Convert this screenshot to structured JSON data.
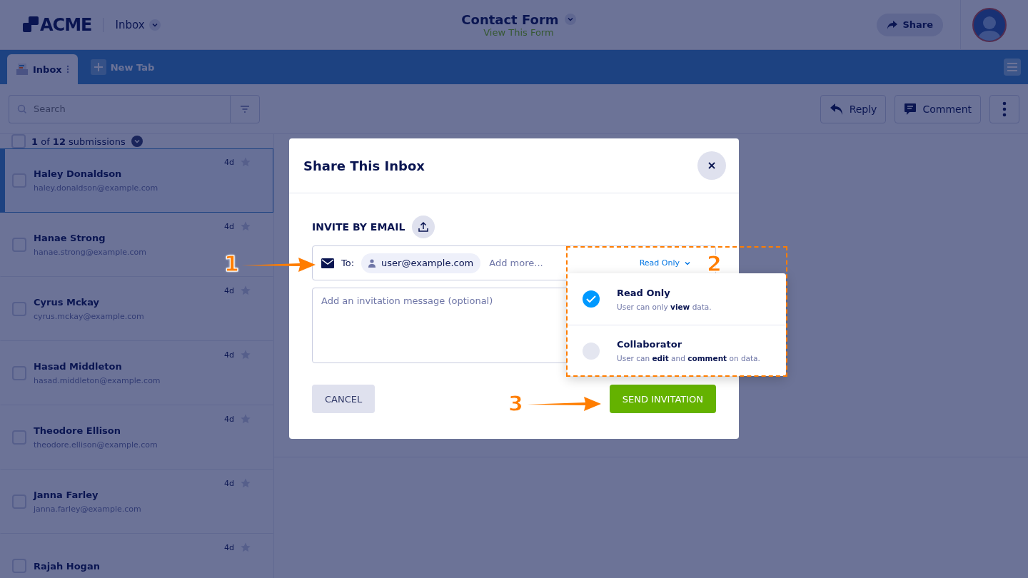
{
  "header": {
    "logo": "ACME",
    "inbox_menu": "Inbox",
    "form_title": "Contact Form",
    "form_link": "View This Form",
    "share_button": "Share"
  },
  "tabs": [
    {
      "label": "Inbox",
      "selected": true,
      "kind": "inbox"
    },
    {
      "label": "New Tab",
      "selected": false,
      "kind": "new"
    }
  ],
  "toolbar": {
    "search": {
      "placeholder": "Search"
    },
    "buttons": [
      {
        "kind": "reply",
        "label": "Reply"
      },
      {
        "kind": "comment",
        "label": "Comment"
      },
      {
        "kind": "more"
      }
    ]
  },
  "list": {
    "summary": "**1** of **12** submissions",
    "checked": false,
    "rows": [
      {
        "name": "Haley Donaldson",
        "email": "haley.donaldson@example.com",
        "age": "4d",
        "selected": true,
        "checked": false
      },
      {
        "name": "Hanae Strong",
        "email": "hanae.strong@example.com",
        "age": "4d",
        "selected": false,
        "checked": false
      },
      {
        "name": "Cyrus Mckay",
        "email": "cyrus.mckay@example.com",
        "age": "4d",
        "selected": false,
        "checked": false
      },
      {
        "name": "Hasad Middleton",
        "email": "hasad.middleton@example.com",
        "age": "4d",
        "selected": false,
        "checked": false
      },
      {
        "name": "Theodore Ellison",
        "email": "theodore.ellison@example.com",
        "age": "4d",
        "selected": false,
        "checked": false
      },
      {
        "name": "Janna Farley",
        "email": "janna.farley@example.com",
        "age": "4d",
        "selected": false,
        "checked": false
      },
      {
        "name": "Rajah Hogan",
        "email": "",
        "age": "4d",
        "selected": false,
        "checked": false
      }
    ]
  },
  "modal": {
    "title": "Share This Inbox",
    "section_title": "INVITE BY EMAIL",
    "to_label": "To:",
    "recipient": "user@example.com",
    "add_placeholder": "Add more...",
    "permission": "Read Only",
    "message_placeholder": "Add an invitation message (optional)",
    "cancel": "CANCEL",
    "send": "SEND INVITATION",
    "options": [
      {
        "title": "Read Only",
        "description": "User can only **view** data.",
        "selected": true
      },
      {
        "title": "Collaborator",
        "description": "User can **edit** and **comment** on data.",
        "selected": false
      }
    ]
  },
  "annotations": [
    "1",
    "2",
    "3"
  ]
}
